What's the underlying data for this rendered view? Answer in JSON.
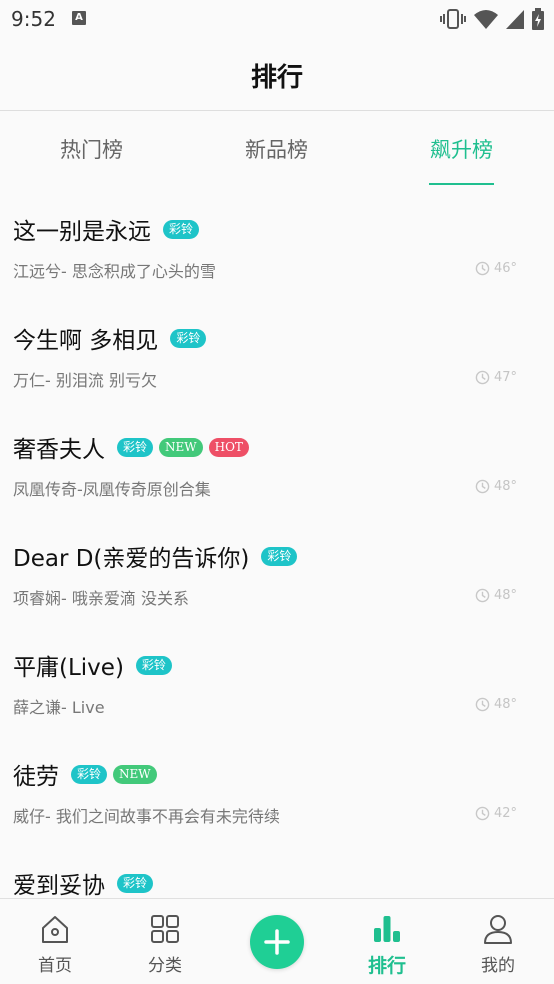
{
  "status_bar": {
    "time": "9:52",
    "notification_icon": "A"
  },
  "header": {
    "title": "排行"
  },
  "tabs": [
    {
      "label": "热门榜",
      "active": false
    },
    {
      "label": "新品榜",
      "active": false
    },
    {
      "label": "飙升榜",
      "active": true
    }
  ],
  "songs": [
    {
      "title": "这一别是永远",
      "badges": [
        "彩铃"
      ],
      "subtitle": "江远兮-  思念积成了心头的雪",
      "count": "46°"
    },
    {
      "title": "今生啊 多相见",
      "badges": [
        "彩铃"
      ],
      "subtitle": "万仁-  别泪流 别亏欠",
      "count": "47°"
    },
    {
      "title": "奢香夫人",
      "badges": [
        "彩铃",
        "NEW",
        "HOT"
      ],
      "subtitle": "凤凰传奇-凤凰传奇原创合集",
      "count": "48°"
    },
    {
      "title": "Dear D(亲爱的告诉你)",
      "badges": [
        "彩铃"
      ],
      "subtitle": "项睿娴-  哦亲爱滴 没关系",
      "count": "48°"
    },
    {
      "title": "平庸(Live)",
      "badges": [
        "彩铃"
      ],
      "subtitle": "薛之谦-  Live",
      "count": "48°"
    },
    {
      "title": "徒劳",
      "badges": [
        "彩铃",
        "NEW"
      ],
      "subtitle": "威仔-  我们之间故事不再会有未完待续",
      "count": "42°"
    },
    {
      "title": "爱到妥协",
      "badges": [
        "彩铃"
      ],
      "subtitle": "",
      "count": ""
    }
  ],
  "bottom_nav": {
    "home": "首页",
    "category": "分类",
    "rank": "排行",
    "mine": "我的"
  },
  "colors": {
    "accent": "#1fbf8f",
    "ring_badge": "#1ec4c8",
    "new_badge": "#42c97a",
    "hot_badge": "#ee4f66"
  },
  "icons": [
    "vibrate-icon",
    "wifi-icon",
    "signal-icon",
    "battery-icon",
    "clock-icon",
    "home-icon",
    "grid-icon",
    "plus-icon",
    "bar-chart-icon",
    "user-icon"
  ]
}
